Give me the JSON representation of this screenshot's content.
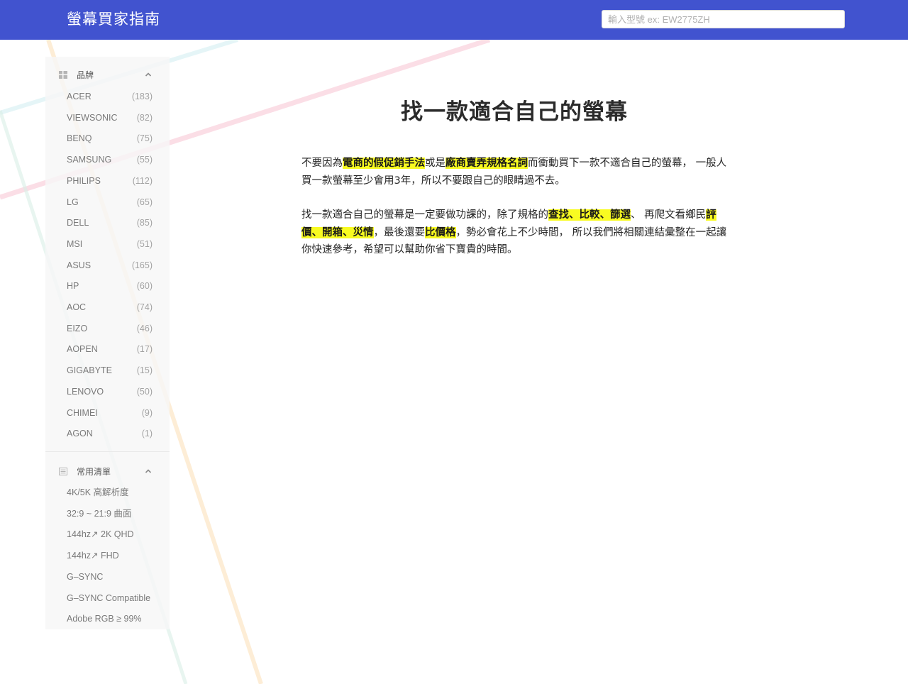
{
  "header": {
    "site_title": "螢幕買家指南",
    "search_placeholder": "輸入型號 ex: EW2775ZH"
  },
  "sidebar": {
    "brands_section": {
      "title": "品牌",
      "icon": "grid-icon",
      "items": [
        {
          "name": "ACER",
          "count": "(183)"
        },
        {
          "name": "VIEWSONIC",
          "count": "(82)"
        },
        {
          "name": "BENQ",
          "count": "(75)"
        },
        {
          "name": "SAMSUNG",
          "count": "(55)"
        },
        {
          "name": "PHILIPS",
          "count": "(112)"
        },
        {
          "name": "LG",
          "count": "(65)"
        },
        {
          "name": "DELL",
          "count": "(85)"
        },
        {
          "name": "MSI",
          "count": "(51)"
        },
        {
          "name": "ASUS",
          "count": "(165)"
        },
        {
          "name": "HP",
          "count": "(60)"
        },
        {
          "name": "AOC",
          "count": "(74)"
        },
        {
          "name": "EIZO",
          "count": "(46)"
        },
        {
          "name": "AOPEN",
          "count": "(17)"
        },
        {
          "name": "GIGABYTE",
          "count": "(15)"
        },
        {
          "name": "LENOVO",
          "count": "(50)"
        },
        {
          "name": "CHIMEI",
          "count": "(9)"
        },
        {
          "name": "AGON",
          "count": "(1)"
        }
      ]
    },
    "lists_section": {
      "title": "常用清單",
      "icon": "list-icon",
      "items": [
        "4K/5K 高解析度",
        "32:9 ~ 21:9 曲面",
        "144hz↗ 2K QHD",
        "144hz↗ FHD",
        "G–SYNC",
        "G–SYNC Compatible",
        "Adobe RGB ≥ 99%"
      ]
    }
  },
  "main": {
    "title": "找一款適合自己的螢幕",
    "para1": {
      "t1": "不要因為",
      "h1": "電商的假促銷手法",
      "t2": "或是",
      "h2": "廠商賣弄規格名詞",
      "t3": "而衝動買下一款不適合自己的螢幕， 一般人買一款螢幕至少會用3年，所以不要跟自己的眼睛過不去。"
    },
    "para2": {
      "t1": "找一款適合自己的螢幕是一定要做功課的，除了規格的",
      "h1": "查找、比較、篩選",
      "t2": "、 再爬文看鄉民",
      "h2": "評價、開箱、災情",
      "t3": "，最後還要",
      "h3": "比價格",
      "t4": "，勢必會花上不少時間， 所以我們將相關連結彙整在一起讓你快速參考，希望可以幫助你省下寶貴的時間。"
    }
  },
  "colors": {
    "header_bg": "#4153cf",
    "highlight": "#f8fb21",
    "sidebar_bg": "#f6f6f6"
  }
}
